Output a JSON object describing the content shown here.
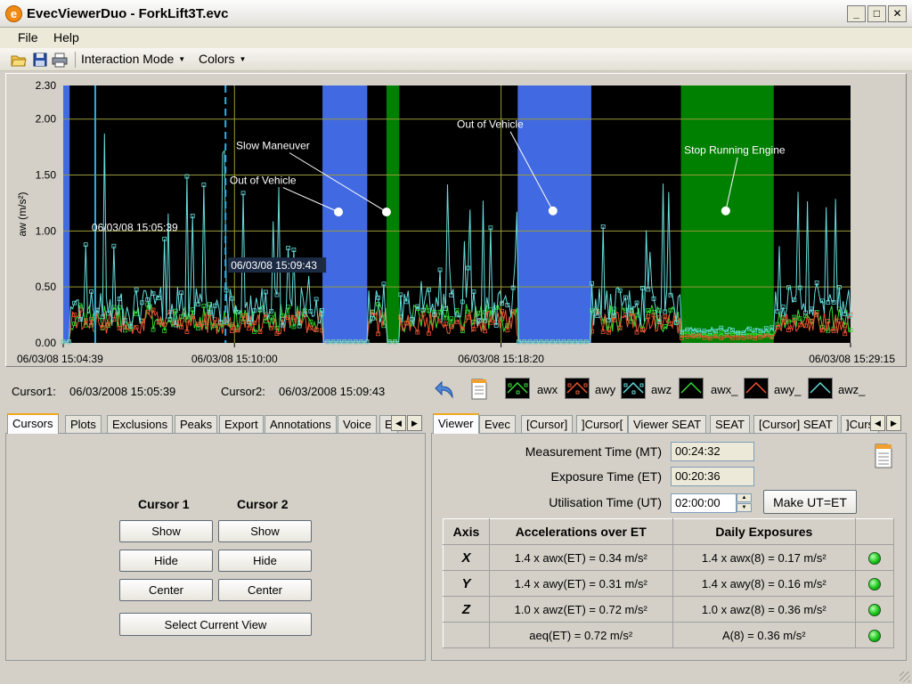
{
  "window": {
    "title": "EvecViewerDuo - ForkLift3T.evc",
    "app_icon": "e-logo-icon"
  },
  "menu": {
    "file": "File",
    "help": "Help"
  },
  "toolbar": {
    "interaction_mode": "Interaction Mode",
    "colors": "Colors"
  },
  "chart_data": {
    "type": "line",
    "ylabel": "aw (m/s²)",
    "ylim": [
      0,
      2.3
    ],
    "yticks": [
      "2.30",
      "2.00",
      "1.50",
      "1.00",
      "0.50",
      "0.00"
    ],
    "ytick_values": [
      2.3,
      2.0,
      1.5,
      1.0,
      0.5,
      0.0
    ],
    "x_tick_labels": [
      "06/03/08 15:04:39",
      "06/03/08 15:10:00",
      "06/03/08 15:18:20",
      "06/03/08 15:29:15"
    ],
    "x_range_minutes": [
      0,
      24.6
    ],
    "x_tick_minutes": [
      0,
      5.35,
      13.68,
      24.6
    ],
    "grid": true,
    "background": "#000000",
    "series": [
      {
        "name": "awx",
        "color": "#33dd33",
        "marker": "square"
      },
      {
        "name": "awy",
        "color": "#ee5533",
        "marker": "square"
      },
      {
        "name": "awz",
        "color": "#66dddd",
        "marker": "square"
      },
      {
        "name": "awx_",
        "color": "#33dd33",
        "marker": "none"
      },
      {
        "name": "awy_",
        "color": "#ee5533",
        "marker": "none"
      },
      {
        "name": "awz_",
        "color": "#66dddd",
        "marker": "none"
      }
    ],
    "exclusion_regions": [
      {
        "start": 0.0,
        "end": 0.2,
        "color": "#4169e1"
      },
      {
        "start": 8.1,
        "end": 9.5,
        "color": "#4169e1"
      },
      {
        "start": 10.1,
        "end": 10.5,
        "color": "#008000"
      },
      {
        "start": 14.2,
        "end": 16.5,
        "color": "#4169e1"
      },
      {
        "start": 19.3,
        "end": 22.2,
        "color": "#008000"
      }
    ],
    "annotations": [
      {
        "text": "Slow Maneuver",
        "x": 5.4,
        "y": 1.73,
        "target_x": 10.1,
        "target_y": 1.17
      },
      {
        "text": "Out of Vehicle",
        "x": 5.2,
        "y": 1.42,
        "target_x": 8.6,
        "target_y": 1.17
      },
      {
        "text": "Out of Vehicle",
        "x": 12.3,
        "y": 1.92,
        "target_x": 15.3,
        "target_y": 1.18
      },
      {
        "text": "Stop Running Engine",
        "x": 19.4,
        "y": 1.69,
        "target_x": 20.7,
        "target_y": 1.18
      }
    ],
    "cursors": [
      {
        "label": "06/03/08 15:05:39",
        "x": 1.0
      },
      {
        "label": "06/03/08 15:09:43",
        "x": 5.07
      }
    ]
  },
  "cursor_row": {
    "cursor1_label": "Cursor1:",
    "cursor1_value": "06/03/2008 15:05:39",
    "cursor2_label": "Cursor2:",
    "cursor2_value": "06/03/2008 15:09:43"
  },
  "legend": [
    "awx",
    "awy",
    "awz",
    "awx_",
    "awy_",
    "awz_"
  ],
  "left_tabs": [
    "Cursors",
    "Plots",
    "Exclusions",
    "Peaks",
    "Export",
    "Annotations",
    "Voice",
    "E"
  ],
  "cursors_panel": {
    "cursor1_heading": "Cursor 1",
    "cursor2_heading": "Cursor 2",
    "show": "Show",
    "hide": "Hide",
    "center": "Center",
    "select_view": "Select Current View"
  },
  "right_tabs": [
    "Viewer",
    "Evec",
    "[Cursor]",
    "]Cursor[",
    "Viewer SEAT",
    "SEAT",
    "[Cursor] SEAT",
    "]Curs"
  ],
  "viewer": {
    "mt_label": "Measurement Time (MT)",
    "mt_value": "00:24:32",
    "et_label": "Exposure Time (ET)",
    "et_value": "00:20:36",
    "ut_label": "Utilisation Time (UT)",
    "ut_value": "02:00:00",
    "make_ut_button": "Make UT=ET",
    "table": {
      "headers": [
        "Axis",
        "Accelerations over ET",
        "Daily Exposures"
      ],
      "rows": [
        {
          "axis": "X",
          "accel": "1.4 x awx(ET) = 0.34 m/s²",
          "daily": "1.4 x awx(8) = 0.17 m/s²"
        },
        {
          "axis": "Y",
          "accel": "1.4 x awy(ET) = 0.31 m/s²",
          "daily": "1.4 x awy(8) = 0.16 m/s²"
        },
        {
          "axis": "Z",
          "accel": "1.0 x awz(ET) = 0.72 m/s²",
          "daily": "1.0 x awz(8) = 0.36 m/s²"
        },
        {
          "axis": "",
          "accel": "aeq(ET) = 0.72 m/s²",
          "daily": "A(8) = 0.36 m/s²"
        }
      ],
      "status_color": "#18c618"
    }
  }
}
